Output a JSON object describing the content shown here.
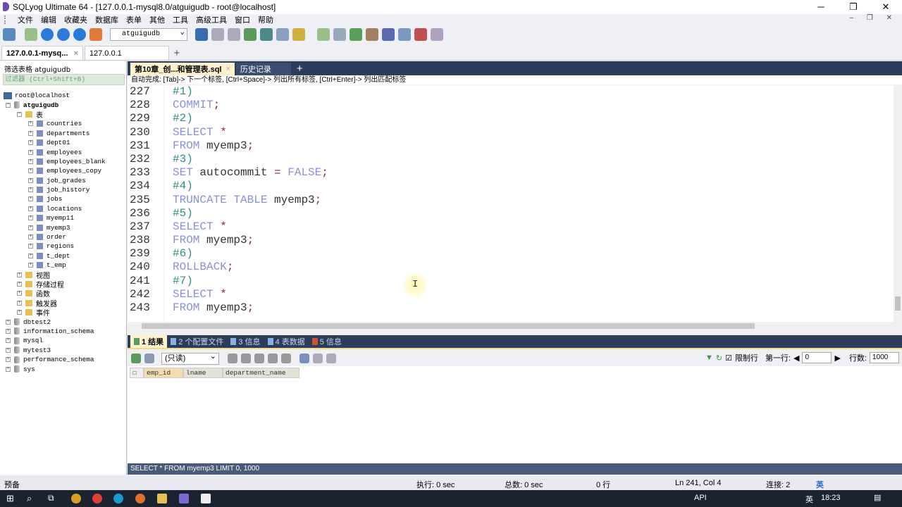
{
  "window": {
    "title": "SQLyog Ultimate 64 - [127.0.0.1-mysql8.0/atguigudb - root@localhost]",
    "min": "─",
    "max": "❐",
    "close": "✕"
  },
  "menu": [
    "文件",
    "编辑",
    "收藏夹",
    "数据库",
    "表单",
    "其他",
    "工具",
    "高级工具",
    "窗口",
    "帮助"
  ],
  "mdi_controls": "‒ ❐ ✕",
  "toolbar": {
    "db_select": "atguigudb"
  },
  "connection_tabs": [
    {
      "label": "127.0.0.1-mysq...",
      "close": "×"
    },
    {
      "label": "127.0.0.1"
    }
  ],
  "add_tab": "+",
  "left": {
    "filter_label": "筛选表格 atguigudb",
    "filter_placeholder": "过滤器 (Ctrl+Shift+B)",
    "host": "root@localhost",
    "db": "atguigudb",
    "tables_folder": "表",
    "tables": [
      "countries",
      "departments",
      "dept01",
      "employees",
      "employees_blank",
      "employees_copy",
      "job_grades",
      "job_history",
      "jobs",
      "locations",
      "myemp11",
      "myemp3",
      "order",
      "regions",
      "t_dept",
      "t_emp"
    ],
    "folders": [
      "视图",
      "存储过程",
      "函数",
      "触发器",
      "事件"
    ],
    "other_dbs": [
      "dbtest2",
      "information_schema",
      "mysql",
      "mytest3",
      "performance_schema",
      "sys"
    ]
  },
  "editor_tabs": [
    {
      "label": "第10章_创...和管理表.sql",
      "close": "×"
    },
    {
      "label": "历史记录"
    }
  ],
  "autocomplete_hint": "自动完成: [Tab]-> 下一个标签, [Ctrl+Space]-> 列出所有标签, [Ctrl+Enter]-> 列出匹配标签",
  "code": [
    {
      "n": "227",
      "t": [
        [
          "c",
          "#1)"
        ]
      ]
    },
    {
      "n": "228",
      "t": [
        [
          "k",
          "COMMIT"
        ],
        [
          "p",
          ";"
        ]
      ]
    },
    {
      "n": "229",
      "t": [
        [
          "c",
          "#2)"
        ]
      ]
    },
    {
      "n": "230",
      "t": [
        [
          "k",
          "SELECT "
        ],
        [
          "p",
          "*"
        ]
      ]
    },
    {
      "n": "231",
      "t": [
        [
          "k",
          "FROM "
        ],
        [
          "i",
          "myemp3"
        ],
        [
          "p",
          ";"
        ]
      ]
    },
    {
      "n": "232",
      "t": [
        [
          "c",
          "#3)"
        ]
      ]
    },
    {
      "n": "233",
      "t": [
        [
          "k",
          "SET "
        ],
        [
          "i",
          "autocommit "
        ],
        [
          "p",
          "= "
        ],
        [
          "k",
          "FALSE"
        ],
        [
          "p",
          ";"
        ]
      ]
    },
    {
      "n": "234",
      "t": [
        [
          "c",
          "#4)"
        ]
      ]
    },
    {
      "n": "235",
      "t": [
        [
          "k",
          "TRUNCATE TABLE "
        ],
        [
          "i",
          "myemp3"
        ],
        [
          "p",
          ";"
        ]
      ]
    },
    {
      "n": "236",
      "t": [
        [
          "c",
          "#5)"
        ]
      ]
    },
    {
      "n": "237",
      "t": [
        [
          "k",
          "SELECT "
        ],
        [
          "p",
          "*"
        ]
      ]
    },
    {
      "n": "238",
      "t": [
        [
          "k",
          "FROM "
        ],
        [
          "i",
          "myemp3"
        ],
        [
          "p",
          ";"
        ]
      ]
    },
    {
      "n": "239",
      "t": [
        [
          "c",
          "#6)"
        ]
      ]
    },
    {
      "n": "240",
      "t": [
        [
          "k",
          "ROLLBACK"
        ],
        [
          "p",
          ";"
        ]
      ]
    },
    {
      "n": "241",
      "t": [
        [
          "c",
          "#7)"
        ]
      ]
    },
    {
      "n": "242",
      "t": [
        [
          "k",
          "SELECT "
        ],
        [
          "p",
          "*"
        ]
      ]
    },
    {
      "n": "243",
      "t": [
        [
          "k",
          "FROM "
        ],
        [
          "i",
          "myemp3"
        ],
        [
          "p",
          ";"
        ]
      ]
    }
  ],
  "cursor": "I",
  "result_tabs": [
    "1 结果",
    "2 个配置文件",
    "3 信息",
    "4 表数据",
    "5 信息"
  ],
  "result_toolbar": {
    "mode": "(只读)",
    "limit_label": "限制行",
    "first_row_label": "第一行:",
    "first_row": "0",
    "rows_label": "行数:",
    "rows": "1000"
  },
  "columns": [
    "emp_id",
    "lname",
    "department_name"
  ],
  "sql_status": "SELECT * FROM myemp3 LIMIT 0, 1000",
  "status": {
    "ready": "预备",
    "exec": "执行: 0 sec",
    "total": "总数: 0 sec",
    "rows": "0 行",
    "pos": "Ln 241, Col 4",
    "conn": "连接: 2",
    "ime": "英"
  },
  "taskbar": {
    "api": "API",
    "lang": "英",
    "time": "18:23"
  },
  "colors": {
    "keyword": "#8a8ee0",
    "comment": "#2f9080",
    "punct": "#8b2a2a",
    "tab_bg": "#2c3d5c"
  }
}
